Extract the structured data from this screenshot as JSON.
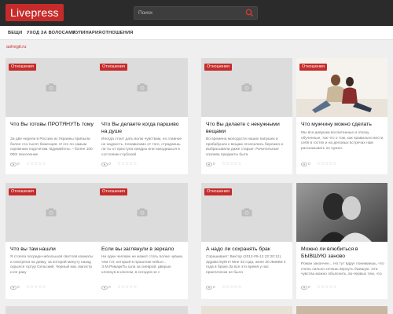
{
  "site": {
    "logo": "Livepress"
  },
  "search": {
    "placeholder": "Поиск"
  },
  "nav": {
    "items": [
      "ВЕЩИ",
      "УХОД ЗА ВОЛОСАМИ",
      "КУЛИНАРИЯ",
      "ОТНОШЕНИЯ"
    ]
  },
  "domain": "ashegit.ru",
  "cards": [
    {
      "badge": "Отношения",
      "title": "Что Вы готовы ПРОТЯНУТЬ тому",
      "excerpt": "За две недели в Россию из Украины прибыли более ста тысяч беженцев. И это по самым скромным подсчетам. Вдумайтесь – более 100 000! Население",
      "views": "0",
      "stars": "☆☆☆☆☆",
      "image": "placeholder"
    },
    {
      "badge": "Отношения",
      "title": "Что Вы делаете когда паршиво на душе",
      "excerpt": "Иногда стоит дать волю чувствам, но главное не надоесть. Независимо от того, страдаешь ли ты от приступа хандры или находишься в состоянии глубокой",
      "views": "0",
      "stars": "☆☆☆☆☆",
      "image": "placeholder"
    },
    {
      "badge": "Отношения",
      "title": "Что Вы делаете с ненужными вещами",
      "excerpt": "Во времена молодости наших бабушек и прабабушек к вещам относились бережно и выбрасывали даже старые. Рачительные хозяева предметы быта",
      "views": "0",
      "stars": "☆☆☆☆☆",
      "image": "placeholder"
    },
    {
      "badge": "Отношения",
      "title": "Что мужчину можно сделать",
      "excerpt": "Мы все девушки воспитанные и отказу обученные, так что о том, как правильно вести себя в гостях и на деловых встречах нам рассказывать не нужно.",
      "views": "0",
      "stars": "☆☆☆☆☆",
      "image": "photo"
    },
    {
      "badge": "Отношения",
      "title": "Что вы там нашли",
      "excerpt": "Я стояла посреди небольшой светлой комнаты и смотрела на девку, за которой минуту назад скрылся Артур Сельский. Черный маг, магистр и ее раку",
      "views": "0",
      "stars": "☆☆☆☆☆",
      "image": "placeholder"
    },
    {
      "badge": "Отношения",
      "title": "Если вы заглянули в зеркало",
      "excerpt": "Ни один человек не может стать более чувым, чем тот, который в прошлом небыл... Э.М.РемаркТы шла за сиеврой, дверью хлопнув в ключом, в сегодня не с",
      "views": "0",
      "stars": "☆☆☆☆☆",
      "image": "placeholder"
    },
    {
      "badge": "Отношения",
      "title": "А надо ли сохранять брак",
      "excerpt": "Спрашивает: Виктор (2012-09-12 22:30:12). Здравствуйте! Мне 33 года, жене 30.Живём 4 года в браке.За все это время у нас практически не было",
      "views": "0",
      "stars": "☆☆☆☆☆",
      "image": "placeholder"
    },
    {
      "badge": "Отношения",
      "title": "Можно ли влюбиться в БЫВШУЮ заново",
      "excerpt": "Роман закончен... Но тут вдруг понимаешь, что очень сильно хочешь вернуть бывшую. Эти чувства можно объяснить, во-первых тем, что",
      "views": "0",
      "stars": "☆☆☆☆☆",
      "image": "photo-bw"
    }
  ]
}
